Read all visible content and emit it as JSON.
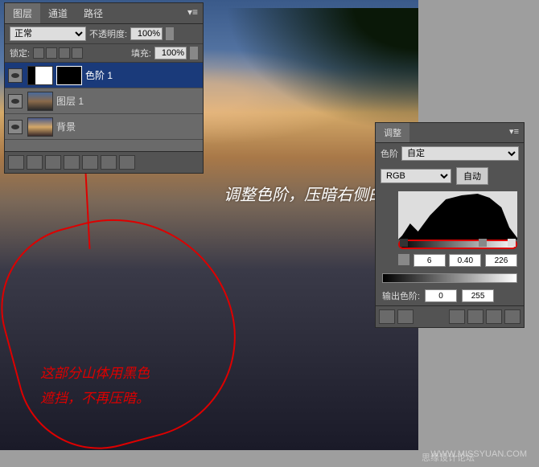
{
  "layers": {
    "tabs": [
      "图层",
      "通道",
      "路径"
    ],
    "blend_mode": "正常",
    "opacity_label": "不透明度:",
    "opacity_value": "100%",
    "lock_label": "锁定:",
    "fill_label": "填充:",
    "fill_value": "100%",
    "items": [
      {
        "name": "色阶 1",
        "selected": true
      },
      {
        "name": "图层 1",
        "selected": false
      },
      {
        "name": "背景",
        "selected": false
      }
    ]
  },
  "adjustments": {
    "tab": "调整",
    "type_label": "色阶",
    "preset": "自定",
    "channel": "RGB",
    "auto": "自动",
    "input_black": "6",
    "input_gamma": "0.40",
    "input_white": "226",
    "output_label": "输出色阶:",
    "output_black": "0",
    "output_white": "255"
  },
  "annotations": {
    "white": "调整色阶，压暗右侧的山体。",
    "red_line1": "这部分山体用黑色",
    "red_line2": "遮挡，不再压暗。"
  },
  "footer": {
    "forum": "思缘设计论坛",
    "url": "WWW.MISSYUAN.COM"
  }
}
